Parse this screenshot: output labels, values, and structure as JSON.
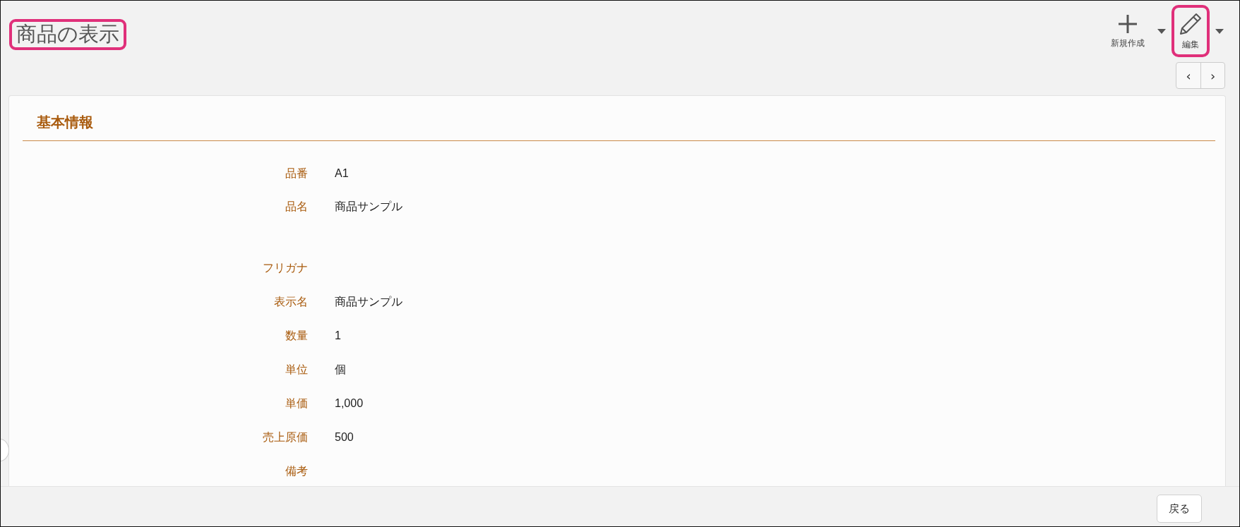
{
  "title": {
    "text": "商品の表示",
    "highlighted": true
  },
  "toolbar": [
    {
      "kind": "add",
      "label": "新規作成",
      "highlighted": false,
      "has_menu": true
    },
    {
      "kind": "edit",
      "label": "編集",
      "highlighted": true,
      "has_menu": true
    }
  ],
  "pager": [
    "‹",
    "›"
  ],
  "section": {
    "title": "基本情報"
  },
  "fields": [
    {
      "kind": "text",
      "label": "品番",
      "value": "A1"
    },
    {
      "kind": "multiline",
      "label": "品名",
      "value": "商品サンプル"
    },
    {
      "kind": "text",
      "label": "フリガナ"
    },
    {
      "kind": "text",
      "label": "表示名",
      "value": "商品サンプル"
    },
    {
      "kind": "text",
      "label": "数量",
      "value": "1"
    },
    {
      "kind": "text",
      "label": "単位",
      "value": "個"
    },
    {
      "kind": "text",
      "label": "単価",
      "value": "1,000"
    },
    {
      "kind": "text",
      "label": "売上原価",
      "value": "500"
    },
    {
      "kind": "text",
      "label": "備考"
    }
  ],
  "footer": {
    "back_button": "戻る"
  }
}
